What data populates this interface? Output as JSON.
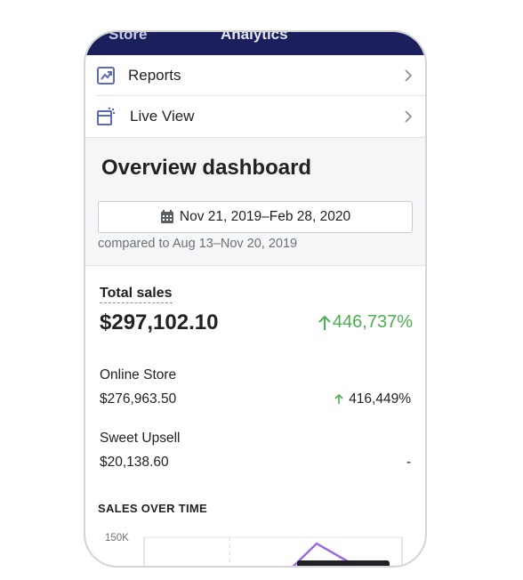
{
  "topbar": {
    "back_label": "Store",
    "title": "Analytics"
  },
  "nav": [
    {
      "label": "Reports",
      "icon": "reports-icon"
    },
    {
      "label": "Live View",
      "icon": "live-view-icon"
    }
  ],
  "overview": {
    "title": "Overview dashboard",
    "date_range": "Nov 21, 2019–Feb 28, 2020",
    "compared": "compared to Aug 13–Nov 20, 2019"
  },
  "total_sales": {
    "label": "Total sales",
    "value": "$297,102.10",
    "change": "446,737%",
    "rows": [
      {
        "name": "Online Store",
        "value": "$276,963.50",
        "change": "416,449%"
      },
      {
        "name": "Sweet Upsell",
        "value": "$20,138.60",
        "change": "-"
      }
    ]
  },
  "sales_over_time": {
    "title": "SALES OVER TIME",
    "y_tick": "150K"
  },
  "colors": {
    "topbar": "#1b1f5c",
    "positive": "#4caf50",
    "icon": "#5c6ac4",
    "series": "#9c6ade"
  }
}
